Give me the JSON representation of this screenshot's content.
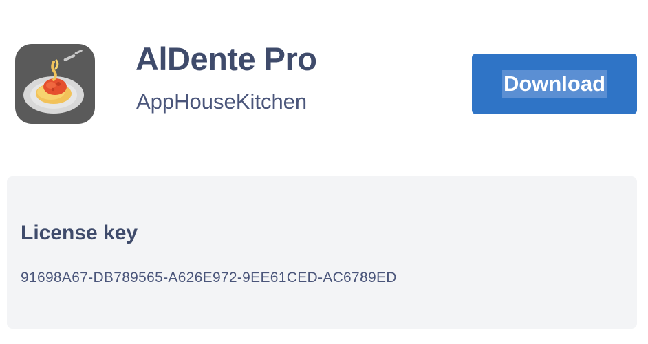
{
  "app": {
    "title": "AlDente Pro",
    "developer": "AppHouseKitchen",
    "icon": "spaghetti-plate-icon"
  },
  "actions": {
    "download_label": "Download"
  },
  "license": {
    "heading": "License key",
    "key": "91698A67-DB789565-A626E972-9EE61CED-AC6789ED"
  },
  "colors": {
    "title": "#3f4b6b",
    "accent": "#2f74c6",
    "card_background": "#f3f4f6",
    "icon_background": "#5a5a5a"
  }
}
